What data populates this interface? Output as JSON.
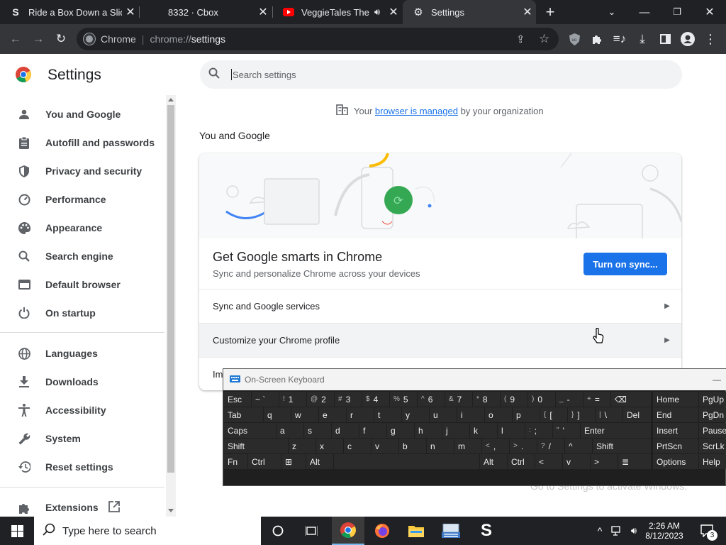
{
  "tabs": [
    {
      "title": "Ride a Box Down a Slid",
      "favicon": "S"
    },
    {
      "title": "8332 · Cbox",
      "favicon": ""
    },
    {
      "title": "VeggieTales Theme",
      "favicon": "youtube-icon"
    },
    {
      "title": "Settings",
      "favicon": "gear-icon"
    }
  ],
  "toolbar": {
    "omnibox_chip": "Chrome",
    "url_prefix": "chrome://",
    "url_host": "settings"
  },
  "settings": {
    "title": "Settings",
    "search_placeholder": "Search settings",
    "managed_prefix": "Your ",
    "managed_link": "browser is managed",
    "managed_suffix": " by your organization",
    "section_title": "You and Google"
  },
  "sidebar": {
    "items": [
      {
        "label": "You and Google",
        "icon": "person-icon"
      },
      {
        "label": "Autofill and passwords",
        "icon": "clipboard-icon"
      },
      {
        "label": "Privacy and security",
        "icon": "shield-icon"
      },
      {
        "label": "Performance",
        "icon": "gauge-icon"
      },
      {
        "label": "Appearance",
        "icon": "palette-icon"
      },
      {
        "label": "Search engine",
        "icon": "search-icon"
      },
      {
        "label": "Default browser",
        "icon": "browser-icon"
      },
      {
        "label": "On startup",
        "icon": "power-icon"
      },
      {
        "label": "Languages",
        "icon": "globe-icon"
      },
      {
        "label": "Downloads",
        "icon": "download-icon"
      },
      {
        "label": "Accessibility",
        "icon": "accessibility-icon"
      },
      {
        "label": "System",
        "icon": "wrench-icon"
      },
      {
        "label": "Reset settings",
        "icon": "history-icon"
      },
      {
        "label": "Extensions",
        "icon": "puzzle-icon"
      }
    ]
  },
  "sync_card": {
    "heading": "Get Google smarts in Chrome",
    "subtext": "Sync and personalize Chrome across your devices",
    "button": "Turn on sync...",
    "rows": [
      "Sync and Google services",
      "Customize your Chrome profile",
      "Im"
    ]
  },
  "watermark": "Go to Settings to activate Windows.",
  "osk": {
    "title": "On-Screen Keyboard",
    "keys": [
      {
        "label": "Esc",
        "sup": ""
      },
      {
        "label": "~ `",
        "sup": ""
      },
      {
        "label": "1",
        "sup": "!"
      },
      {
        "label": "2",
        "sup": "@"
      },
      {
        "label": "3",
        "sup": "#"
      },
      {
        "label": "4",
        "sup": "$"
      },
      {
        "label": "5",
        "sup": "%"
      },
      {
        "label": "6",
        "sup": "^"
      },
      {
        "label": "7",
        "sup": "&"
      },
      {
        "label": "8",
        "sup": "*"
      },
      {
        "label": "9",
        "sup": "("
      },
      {
        "label": "0",
        "sup": ")"
      },
      {
        "label": "-",
        "sup": "_"
      },
      {
        "label": "=",
        "sup": "+"
      },
      {
        "label": "⌫",
        "sup": ""
      },
      {
        "label": "Home",
        "sup": ""
      },
      {
        "label": "PgUp",
        "sup": ""
      },
      {
        "label": "Tab",
        "sup": ""
      },
      {
        "label": "q",
        "sup": ""
      },
      {
        "label": "w",
        "sup": ""
      },
      {
        "label": "e",
        "sup": ""
      },
      {
        "label": "r",
        "sup": ""
      },
      {
        "label": "t",
        "sup": ""
      },
      {
        "label": "y",
        "sup": ""
      },
      {
        "label": "u",
        "sup": ""
      },
      {
        "label": "i",
        "sup": ""
      },
      {
        "label": "o",
        "sup": ""
      },
      {
        "label": "p",
        "sup": ""
      },
      {
        "label": "[",
        "sup": "{"
      },
      {
        "label": "]",
        "sup": "}"
      },
      {
        "label": "\\",
        "sup": "|"
      },
      {
        "label": "Del",
        "sup": ""
      },
      {
        "label": "End",
        "sup": ""
      },
      {
        "label": "PgDn",
        "sup": ""
      },
      {
        "label": "Caps",
        "sup": ""
      },
      {
        "label": "a",
        "sup": ""
      },
      {
        "label": "s",
        "sup": ""
      },
      {
        "label": "d",
        "sup": ""
      },
      {
        "label": "f",
        "sup": ""
      },
      {
        "label": "g",
        "sup": ""
      },
      {
        "label": "h",
        "sup": ""
      },
      {
        "label": "j",
        "sup": ""
      },
      {
        "label": "k",
        "sup": ""
      },
      {
        "label": "l",
        "sup": ""
      },
      {
        "label": ";",
        "sup": ":"
      },
      {
        "label": "'",
        "sup": "\""
      },
      {
        "label": "Enter",
        "sup": ""
      },
      {
        "label": "Insert",
        "sup": ""
      },
      {
        "label": "Pause",
        "sup": ""
      },
      {
        "label": "Shift",
        "sup": ""
      },
      {
        "label": "z",
        "sup": ""
      },
      {
        "label": "x",
        "sup": ""
      },
      {
        "label": "c",
        "sup": ""
      },
      {
        "label": "v",
        "sup": ""
      },
      {
        "label": "b",
        "sup": ""
      },
      {
        "label": "n",
        "sup": ""
      },
      {
        "label": "m",
        "sup": ""
      },
      {
        "label": ",",
        "sup": "<"
      },
      {
        "label": ".",
        "sup": ">"
      },
      {
        "label": "/",
        "sup": "?"
      },
      {
        "label": "^",
        "sup": ""
      },
      {
        "label": "Shift",
        "sup": ""
      },
      {
        "label": "PrtScn",
        "sup": ""
      },
      {
        "label": "ScrLk",
        "sup": ""
      },
      {
        "label": "Fn",
        "sup": ""
      },
      {
        "label": "Ctrl",
        "sup": ""
      },
      {
        "label": "⊞",
        "sup": ""
      },
      {
        "label": "Alt",
        "sup": ""
      },
      {
        "label": "",
        "sup": ""
      },
      {
        "label": "Alt",
        "sup": ""
      },
      {
        "label": "Ctrl",
        "sup": ""
      },
      {
        "label": "<",
        "sup": ""
      },
      {
        "label": "v",
        "sup": ""
      },
      {
        "label": ">",
        "sup": ""
      },
      {
        "label": "≣",
        "sup": ""
      },
      {
        "label": "Options",
        "sup": ""
      },
      {
        "label": "Help",
        "sup": ""
      }
    ]
  },
  "taskbar": {
    "search_placeholder": "Type here to search",
    "time": "2:26 AM",
    "date": "8/12/2023",
    "notification_count": "3"
  }
}
